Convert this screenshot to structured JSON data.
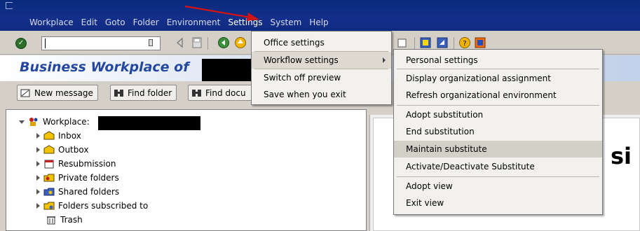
{
  "menubar": {
    "items": [
      "Workplace",
      "Edit",
      "Goto",
      "Folder",
      "Environment",
      "Settings",
      "System",
      "Help"
    ],
    "active_index": 5
  },
  "toolbar": {
    "command_field_value": ""
  },
  "title": {
    "text": "Business Workplace of"
  },
  "app_toolbar": {
    "buttons": [
      "New message",
      "Find folder",
      "Find docu"
    ]
  },
  "tree": {
    "root": "Workplace:",
    "items": [
      "Inbox",
      "Outbox",
      "Resubmission",
      "Private folders",
      "Shared folders",
      "Folders subscribed to",
      "Trash"
    ]
  },
  "right_panel": {
    "partial_text": "si"
  },
  "settings_menu": {
    "items": [
      "Office settings",
      "Workflow settings",
      "Switch off preview",
      "Save when you exit"
    ],
    "highlighted_index": 1
  },
  "workflow_submenu": {
    "items": [
      "Personal settings",
      "Display organizational assignment",
      "Refresh organizational environment",
      "Adopt substitution",
      "End substitution",
      "Maintain substitute",
      "Activate/Deactivate Substitute",
      "Adopt view",
      "Exit view"
    ],
    "highlighted_index": 5
  },
  "colors": {
    "menubar_bg": "#132f8a",
    "title_text": "#24489d",
    "arrow": "#d21414"
  }
}
